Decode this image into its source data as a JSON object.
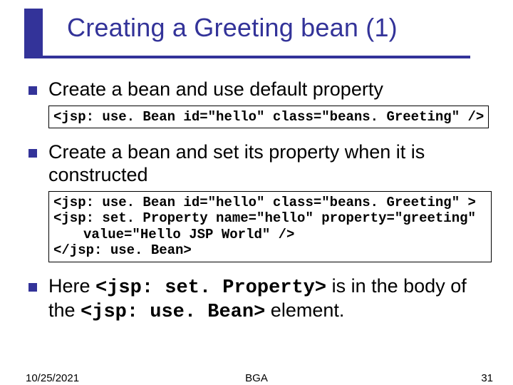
{
  "title": "Creating a Greeting bean (1)",
  "bullets": {
    "b1": "Create a bean and use default property",
    "b2": "Create a bean and set its property when it is constructed",
    "b3_pre": "Here ",
    "b3_code1": "<jsp: set. Property>",
    "b3_mid": " is in the body of the ",
    "b3_code2": "<jsp: use. Bean>",
    "b3_post": " element."
  },
  "code1": "<jsp: use. Bean id=\"hello\" class=\"beans. Greeting\" />",
  "code2_l1": "<jsp: use. Bean id=\"hello\" class=\"beans. Greeting\" >",
  "code2_l2": "<jsp: set. Property name=\"hello\" property=\"greeting\"",
  "code2_l3": "value=\"Hello JSP World\" />",
  "code2_l4": "</jsp: use. Bean>",
  "footer": {
    "date": "10/25/2021",
    "center": "BGA",
    "page": "31"
  }
}
